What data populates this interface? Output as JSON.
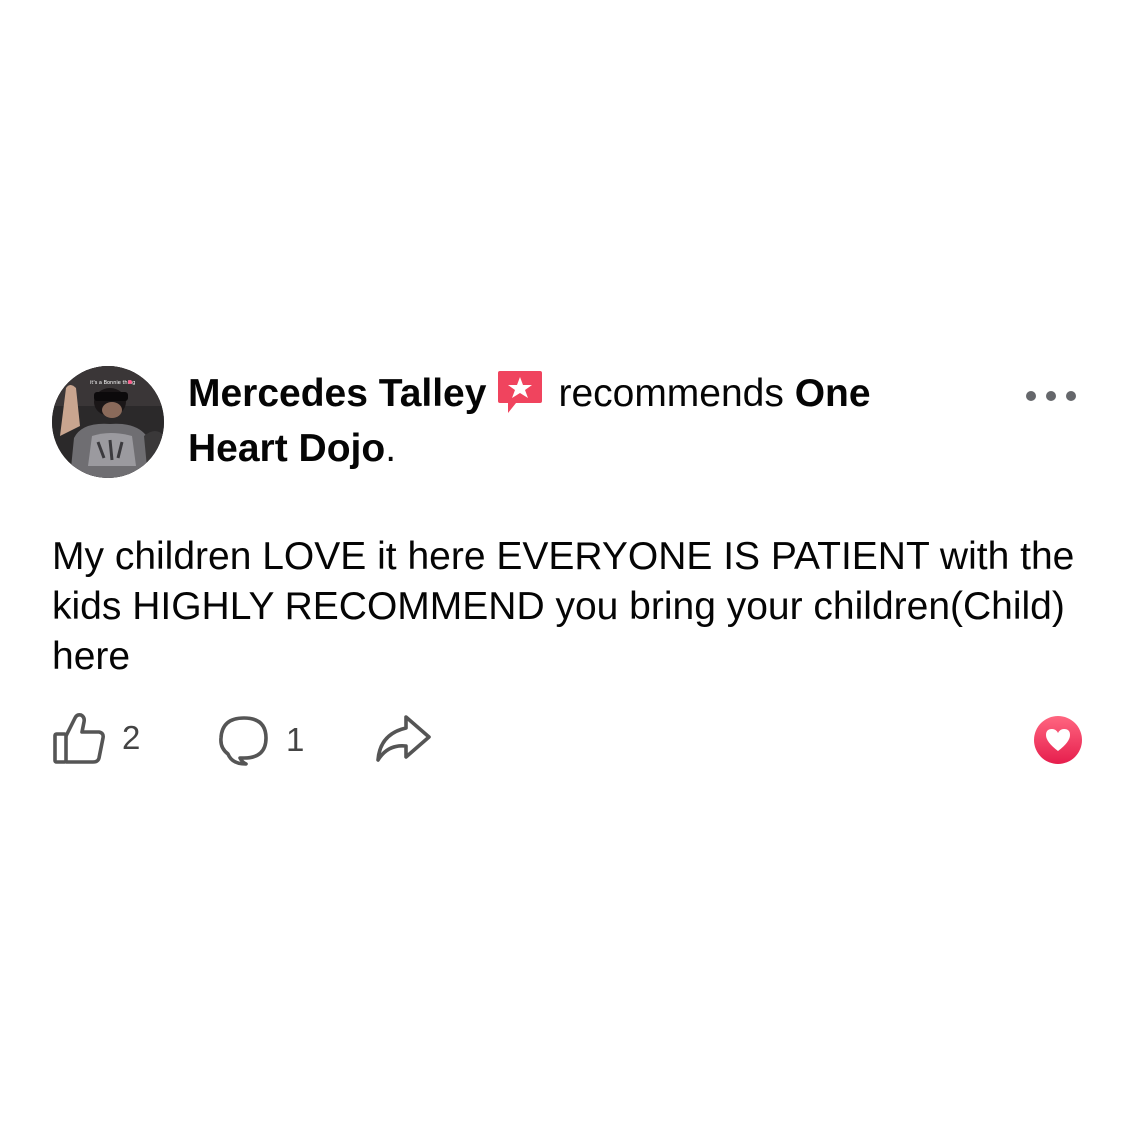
{
  "post": {
    "author": "Mercedes Talley",
    "verb": "recommends",
    "target": "One Heart Dojo",
    "target_punct": ".",
    "body": "My children LOVE it here EVERYONE IS PATIENT with the kids HIGHLY RECOMMEND you bring your children(Child) here",
    "badge_icon": "recommendation-star-icon",
    "avatar_icon": "profile-photo",
    "avatar_caption": "it's a Bonnie thing",
    "badge_color": "#f0445e"
  },
  "actions": {
    "like_count": "2",
    "comment_count": "1",
    "like_icon": "thumbs-up-icon",
    "comment_icon": "comment-bubble-icon",
    "share_icon": "share-arrow-icon",
    "reaction_icon": "love-heart-icon",
    "reaction_color": "#f0284a"
  }
}
